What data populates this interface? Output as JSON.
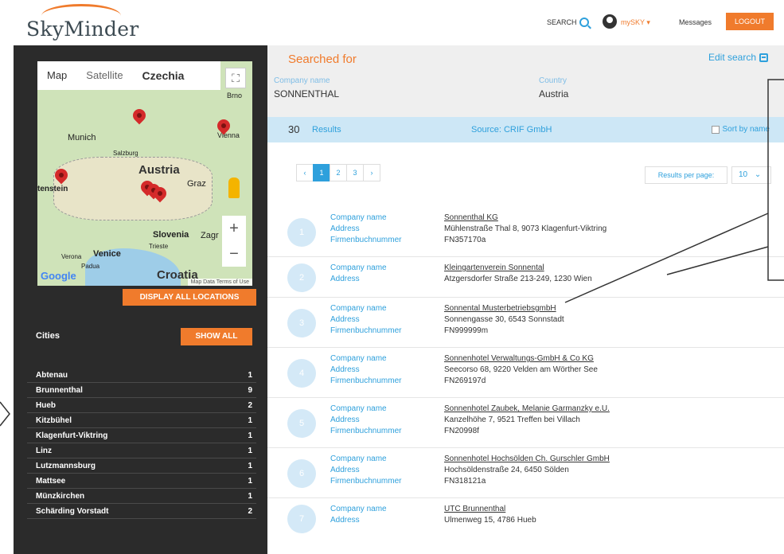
{
  "header": {
    "logo": "SkyMinder",
    "search_label": "SEARCH",
    "mysky_label": "mySKY",
    "messages_label": "Messages",
    "logout_label": "LOGOUT"
  },
  "map": {
    "tab_map": "Map",
    "tab_satellite": "Satellite",
    "labels": {
      "czechia": "Czechia",
      "munich": "Munich",
      "salzburg": "Salzburg",
      "austria": "Austria",
      "graz": "Graz",
      "slovenia": "Slovenia",
      "zagreb": "Zagr",
      "trieste": "Trieste",
      "venice": "Venice",
      "verona": "Verona",
      "padua": "Padua",
      "croatia": "Croatia",
      "vienna": "Vienna",
      "brno": "Brno",
      "liechtenstein": "tenstein"
    },
    "google": "Google",
    "terms": "Map Data  Terms of Use"
  },
  "sidebar": {
    "display_all_locations": "DISPLAY ALL LOCATIONS",
    "cities_label": "Cities",
    "show_all": "SHOW ALL",
    "cities": [
      {
        "name": "Abtenau",
        "count": "1"
      },
      {
        "name": "Brunnenthal",
        "count": "9"
      },
      {
        "name": "Hueb",
        "count": "2"
      },
      {
        "name": "Kitzbühel",
        "count": "1"
      },
      {
        "name": "Klagenfurt-Viktring",
        "count": "1"
      },
      {
        "name": "Linz",
        "count": "1"
      },
      {
        "name": "Lutzmannsburg",
        "count": "1"
      },
      {
        "name": "Mattsee",
        "count": "1"
      },
      {
        "name": "Münzkirchen",
        "count": "1"
      },
      {
        "name": "Schärding Vorstadt",
        "count": "2"
      }
    ]
  },
  "search": {
    "title": "Searched for",
    "edit_label": "Edit search",
    "company_label": "Company name",
    "company_value": "SONNENTHAL",
    "country_label": "Country",
    "country_value": "Austria"
  },
  "results": {
    "count": "30",
    "word": "Results",
    "source": "Source: CRIF GmbH",
    "sort_label": "Sort by name",
    "pages": [
      "‹",
      "1",
      "2",
      "3",
      "›"
    ],
    "per_page_label": "Results per page:",
    "per_page_value": "10",
    "label_company": "Company name",
    "label_address": "Address",
    "label_fn": "Firmenbuchnummer",
    "items": [
      {
        "num": "1",
        "name": "Sonnenthal KG",
        "address": "Mühlenstraße Thal 8, 9073 Klagenfurt-Viktring",
        "fn": "FN357170a"
      },
      {
        "num": "2",
        "name": "Kleingartenverein Sonnental",
        "address": "Atzgersdorfer Straße 213-249, 1230 Wien",
        "fn": ""
      },
      {
        "num": "3",
        "name": "Sonnental MusterbetriebsgmbH",
        "address": "Sonnengasse 30, 6543 Sonnstadt",
        "fn": "FN999999m"
      },
      {
        "num": "4",
        "name": "Sonnenhotel Verwaltungs-GmbH & Co KG",
        "address": "Seecorso 68, 9220 Velden am Wörther See",
        "fn": "FN269197d"
      },
      {
        "num": "5",
        "name": "Sonnenhotel Zaubek, Melanie Garmanzky e.U.",
        "address": "Kanzelhöhe 7, 9521 Treffen bei Villach",
        "fn": "FN20998f"
      },
      {
        "num": "6",
        "name": "Sonnenhotel Hochsölden Ch. Gurschler GmbH",
        "address": "Hochsöldenstraße 24, 6450 Sölden",
        "fn": "FN318121a"
      },
      {
        "num": "7",
        "name": "UTC Brunnenthal",
        "address": "Ulmenweg 15, 4786 Hueb",
        "fn": ""
      }
    ]
  }
}
